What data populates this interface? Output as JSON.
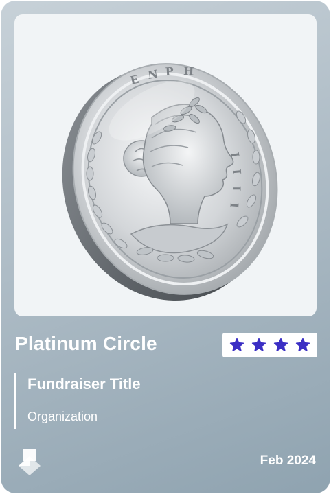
{
  "card": {
    "tier_title": "Platinum Circle",
    "rating": {
      "value": 4,
      "max": 4,
      "star_color": "#3b2fc4"
    },
    "fundraiser_title": "Fundraiser Title",
    "organization": "Organization",
    "date": "Feb 2024",
    "image": {
      "subject": "silver coin with laureate portrait",
      "icon": "coin-image"
    },
    "logo_icon": "brand-logo-icon"
  }
}
